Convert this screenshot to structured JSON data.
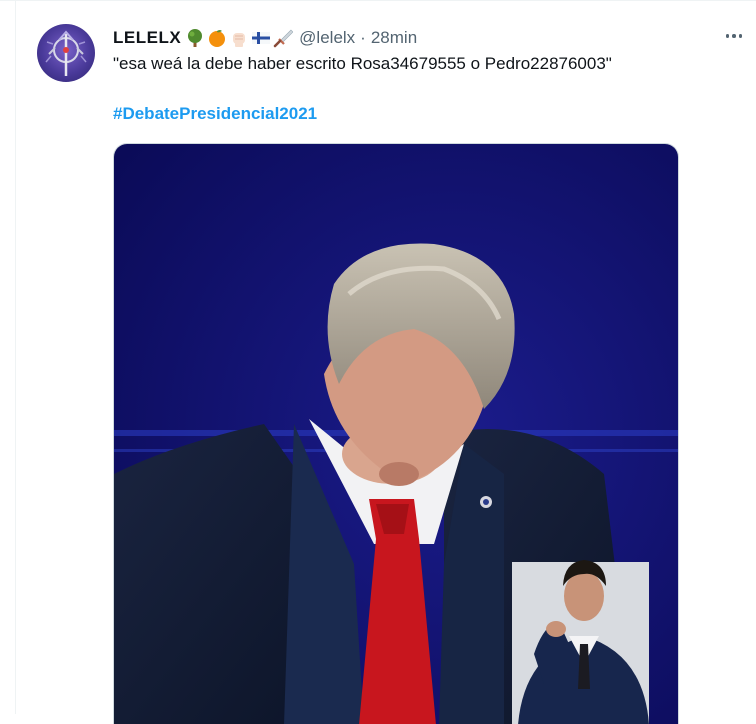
{
  "tweet": {
    "display_name": "LELELX",
    "name_emojis": [
      "tree-icon",
      "orange-icon",
      "raised-fist-icon",
      "finland-flag-icon",
      "dagger-icon"
    ],
    "handle": "@lelelx",
    "separator": "·",
    "timestamp": "28min",
    "text": "\"esa weá la debe haber escrito Rosa34679555 o Pedro22876003\"",
    "hashtag": "#DebatePresidencial2021",
    "more_icon": "more-options-icon",
    "media": {
      "kind": "video-frame",
      "background_color": "#10106a",
      "inset": "sign-language-interpreter"
    }
  },
  "colors": {
    "text_primary": "#0f1419",
    "text_secondary": "#536471",
    "link_blue": "#1d9bf0",
    "divider": "#eff3f4"
  }
}
